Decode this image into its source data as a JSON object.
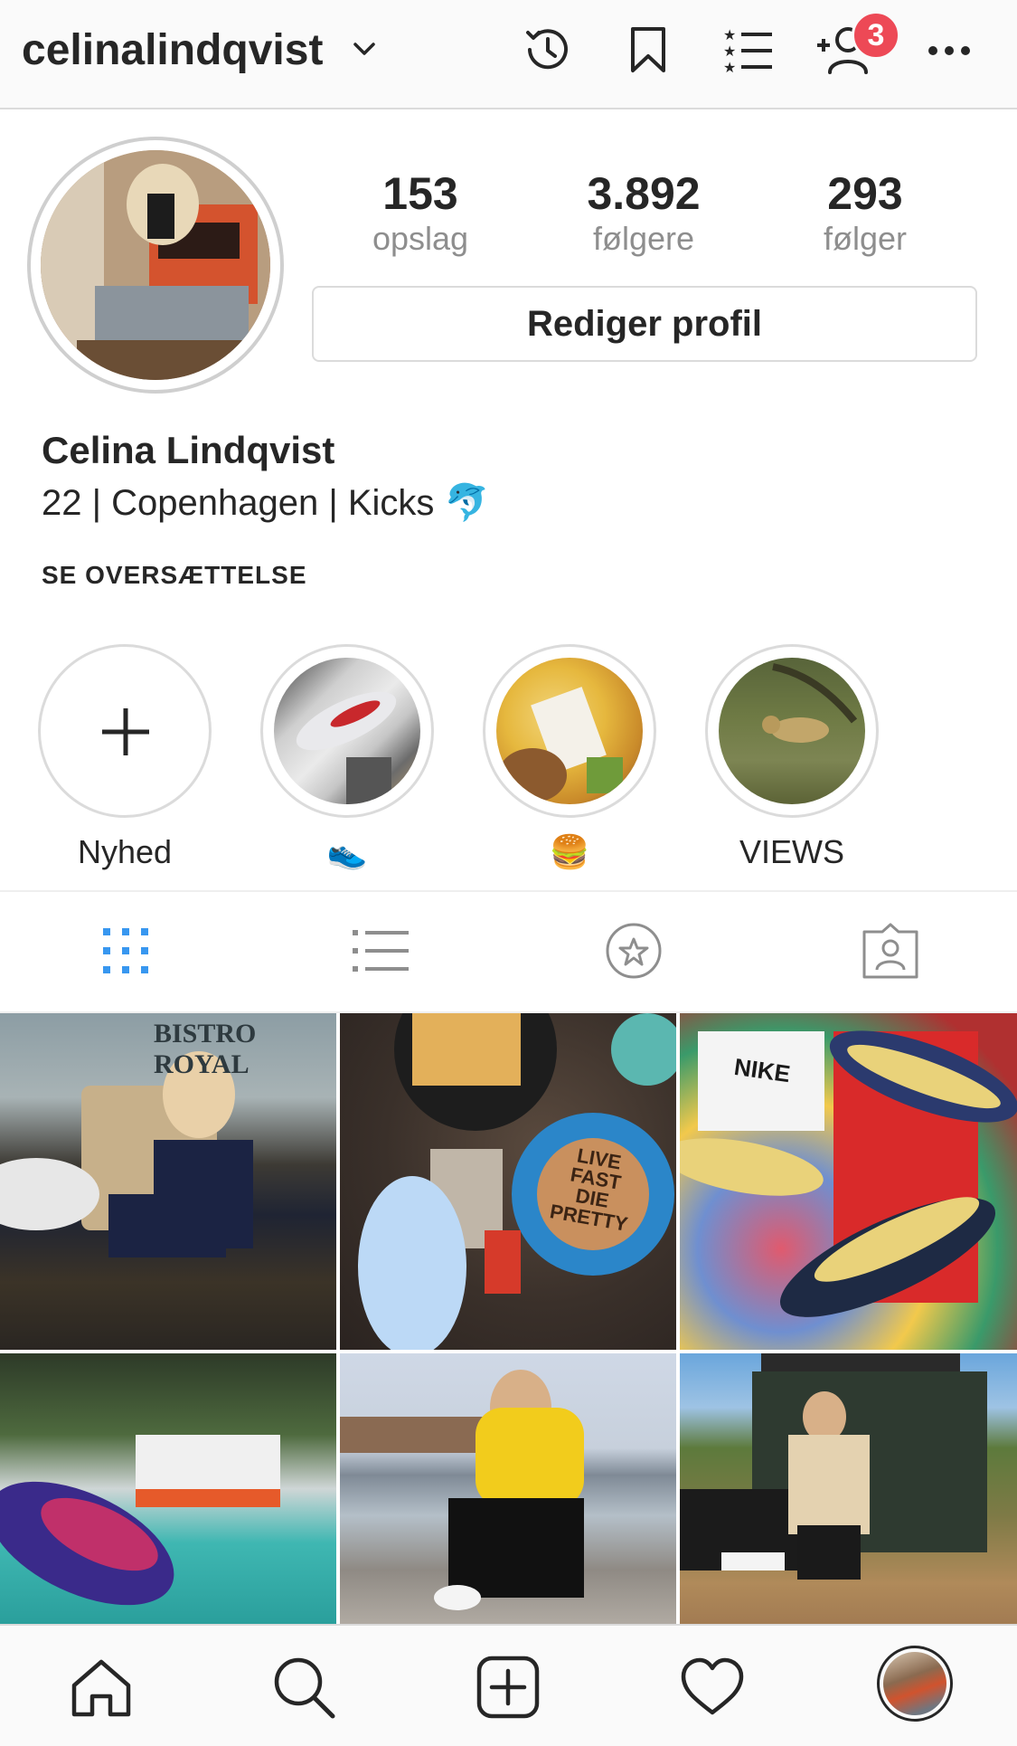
{
  "header": {
    "username": "celinalindqvist",
    "notification_count": "3",
    "icons": [
      "chevron-down-icon",
      "history-icon",
      "bookmark-icon",
      "close-friends-list-icon",
      "add-user-icon",
      "more-icon"
    ]
  },
  "profile": {
    "stats": [
      {
        "value": "153",
        "label": "opslag"
      },
      {
        "value": "3.892",
        "label": "følgere"
      },
      {
        "value": "293",
        "label": "følger"
      }
    ],
    "edit_button": "Rediger profil",
    "full_name": "Celina Lindqvist",
    "bio": "22 | Copenhagen | Kicks 🐬",
    "translate_link": "SE OVERSÆTTELSE"
  },
  "highlights": [
    {
      "label": "Nyhed"
    },
    {
      "label": "👟"
    },
    {
      "label": "🍔"
    },
    {
      "label": "VIEWS"
    }
  ],
  "tabs": [
    "grid-icon",
    "list-icon",
    "saved-star-icon",
    "tagged-icon"
  ],
  "grid": {
    "posts": [
      {
        "caption": "BISTRO ROYAL"
      },
      {
        "caption": "LIVE FAST DIE PRETTY"
      },
      {
        "caption": "NIKE"
      },
      {
        "caption": ""
      },
      {
        "caption": ""
      },
      {
        "caption": ""
      }
    ]
  },
  "bottom_nav": [
    "home-icon",
    "search-icon",
    "new-post-icon",
    "activity-heart-icon",
    "profile-avatar"
  ],
  "colors": {
    "accent_blue": "#3897f0",
    "badge_red": "#ed4956",
    "text": "#262626",
    "muted": "#8e8e8e"
  }
}
